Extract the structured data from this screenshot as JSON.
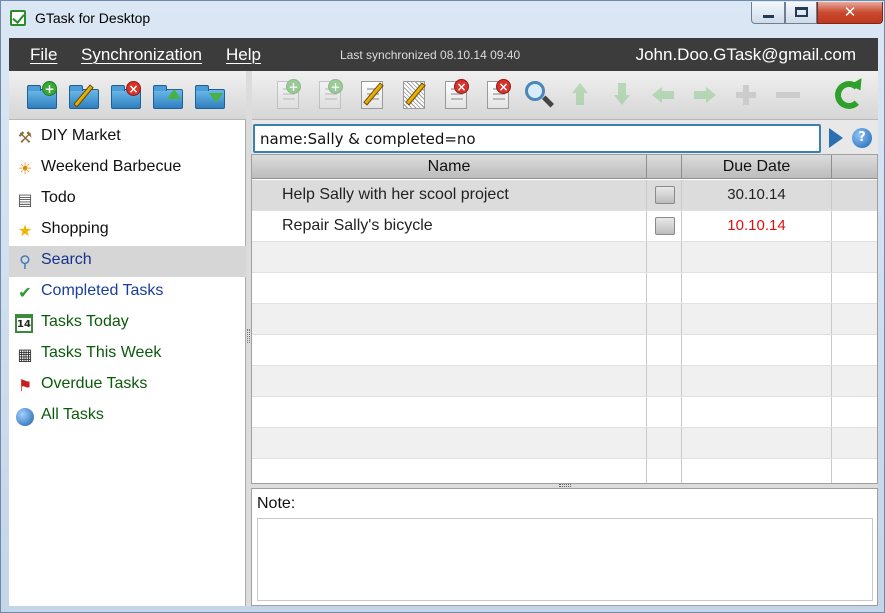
{
  "window": {
    "title": "GTask for Desktop",
    "minimize": "",
    "maximize": "",
    "close": "✕"
  },
  "menubar": {
    "file": "File",
    "synchronization": "Synchronization",
    "help": "Help",
    "sync_status": "Last synchronized 08.10.14 09:40",
    "account": "John.Doo.GTask@gmail.com"
  },
  "left_toolbar": {
    "buttons": [
      "add-list",
      "edit-list",
      "delete-list",
      "export-list",
      "import-list"
    ]
  },
  "lists": [
    {
      "label": "DIY Market",
      "icon": "hammer-icon"
    },
    {
      "label": "Weekend Barbecue",
      "icon": "sun-icon"
    },
    {
      "label": "Todo",
      "icon": "clipboard-icon"
    },
    {
      "label": "Shopping",
      "icon": "star-icon"
    },
    {
      "label": "Search",
      "icon": "magnifier-icon",
      "selected": true
    },
    {
      "label": "Completed Tasks",
      "icon": "checkmark-icon"
    },
    {
      "label": "Tasks Today",
      "icon": "calendar-icon",
      "icon_text": "14"
    },
    {
      "label": "Tasks This Week",
      "icon": "clapperboard-icon"
    },
    {
      "label": "Overdue Tasks",
      "icon": "flag-icon"
    },
    {
      "label": "All Tasks",
      "icon": "globe-icon"
    }
  ],
  "search": {
    "query": "name:Sally & completed=no",
    "help_symbol": "?"
  },
  "table": {
    "columns": {
      "name": "Name",
      "done": "",
      "due": "Due Date",
      "extra": ""
    },
    "rows": [
      {
        "name": "Help Sally with her scool project",
        "completed": false,
        "due": "30.10.14",
        "overdue": false,
        "selected": true
      },
      {
        "name": "Repair Sally's bicycle",
        "completed": false,
        "due": "10.10.14",
        "overdue": true,
        "selected": false
      }
    ]
  },
  "note": {
    "label": "Note:",
    "value": ""
  },
  "colors": {
    "menubar_bg": "#3c3c3c",
    "overdue": "#e01010",
    "selected_row": "#dcdcdc",
    "search_border": "#3c7fb1"
  }
}
